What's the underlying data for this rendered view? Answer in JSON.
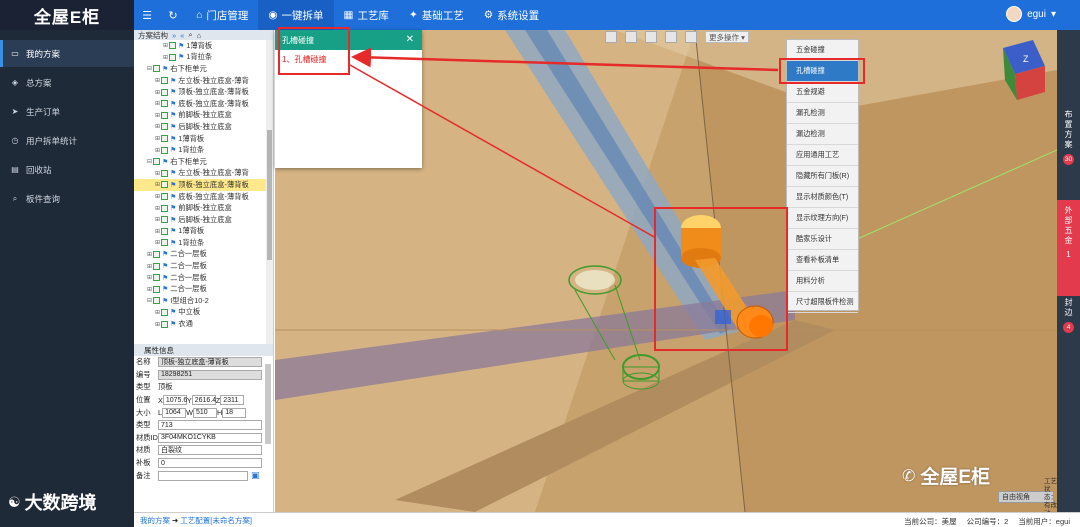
{
  "app": {
    "logo": "全屋E柜"
  },
  "menu": [
    {
      "label": "门店管理",
      "icon": "⌂"
    },
    {
      "label": "一键拆单",
      "icon": "◉"
    },
    {
      "label": "工艺库",
      "icon": "▦"
    },
    {
      "label": "基础工艺",
      "icon": "✦"
    },
    {
      "label": "系统设置",
      "icon": "⚙"
    }
  ],
  "user": {
    "name": "egui"
  },
  "sidebar": [
    {
      "label": "我的方案",
      "icon": "▭"
    },
    {
      "label": "总方案",
      "icon": "◈"
    },
    {
      "label": "生产订单",
      "icon": "➤"
    },
    {
      "label": "用户拆单统计",
      "icon": "◷"
    },
    {
      "label": "回收站",
      "icon": "▤"
    },
    {
      "label": "板件查询",
      "icon": "⌕"
    }
  ],
  "sidebar_footer": "大数跨境",
  "tree": {
    "header": "方案结构",
    "rows": [
      {
        "label": "1薄背板",
        "indent": 3,
        "type": "leaf"
      },
      {
        "label": "1背拉条",
        "indent": 3,
        "type": "leaf"
      },
      {
        "label": "右下柜单元",
        "indent": 1,
        "type": "node"
      },
      {
        "label": "左立板-独立底盒-薄背",
        "indent": 2,
        "type": "leaf"
      },
      {
        "label": "顶板-独立底盒-薄背板",
        "indent": 2,
        "type": "leaf"
      },
      {
        "label": "底板-独立底盒-薄背板",
        "indent": 2,
        "type": "leaf"
      },
      {
        "label": "前脚板-独立底盒",
        "indent": 2,
        "type": "leaf"
      },
      {
        "label": "后脚板-独立底盒",
        "indent": 2,
        "type": "leaf"
      },
      {
        "label": "1薄背板",
        "indent": 2,
        "type": "leaf"
      },
      {
        "label": "1背拉条",
        "indent": 2,
        "type": "leaf"
      },
      {
        "label": "右下柜单元",
        "indent": 1,
        "type": "node"
      },
      {
        "label": "左立板-独立底盒-薄背",
        "indent": 2,
        "type": "leaf"
      },
      {
        "label": "顶板-独立底盒-薄背板",
        "indent": 2,
        "type": "leaf",
        "highlight": true
      },
      {
        "label": "底板-独立底盒-薄背板",
        "indent": 2,
        "type": "leaf"
      },
      {
        "label": "前脚板-独立底盒",
        "indent": 2,
        "type": "leaf"
      },
      {
        "label": "后脚板-独立底盒",
        "indent": 2,
        "type": "leaf"
      },
      {
        "label": "1薄背板",
        "indent": 2,
        "type": "leaf"
      },
      {
        "label": "1背拉条",
        "indent": 2,
        "type": "leaf"
      },
      {
        "label": "二合一层板",
        "indent": 1,
        "type": "leaf"
      },
      {
        "label": "二合一层板",
        "indent": 1,
        "type": "leaf"
      },
      {
        "label": "二合一层板",
        "indent": 1,
        "type": "leaf"
      },
      {
        "label": "二合一层板",
        "indent": 1,
        "type": "leaf"
      },
      {
        "label": "I型组合10-2",
        "indent": 1,
        "type": "node"
      },
      {
        "label": "中立板",
        "indent": 2,
        "type": "leaf"
      },
      {
        "label": "衣通",
        "indent": 2,
        "type": "leaf"
      }
    ]
  },
  "props": {
    "header": "属性信息",
    "name_label": "名称",
    "name_value": "顶板-独立底盒-薄背板",
    "id_label": "编号",
    "id_value": "18298251",
    "type_label": "类型",
    "type_value": "顶板",
    "pos_label": "位置",
    "pos_x": "1075.6",
    "pos_y": "2616.4",
    "pos_z": "2311",
    "size_label": "大小",
    "size_l": "1064",
    "size_w": "510",
    "size_h": "18",
    "kind_label": "类型",
    "kind_value": "713",
    "mat_id_label": "材质ID",
    "mat_id_value": "3F04MKO1CYKB",
    "mat_label": "材质",
    "mat_value": "白裂纹",
    "patch_label": "补板",
    "patch_value": "0",
    "note_label": "备注",
    "note_value": ""
  },
  "breadcrumb": {
    "root": "我的方案",
    "arrow": "➜",
    "current": "工艺配置[未命名方案]"
  },
  "status": {
    "company": "当前公司：美屋",
    "company_no": "公司编号：2",
    "user": "当前用户：egui"
  },
  "dialog": {
    "title": "孔槽碰撞",
    "item": "1、孔槽碰撞"
  },
  "more_ops": "更多操作 ▾",
  "dropdown": [
    {
      "label": "五金碰撞"
    },
    {
      "label": "孔槽碰撞",
      "active": true
    },
    {
      "label": "五金规避"
    },
    {
      "label": "漏孔检测"
    },
    {
      "label": "漏边检测"
    },
    {
      "label": "应用通用工艺"
    },
    {
      "label": "隐藏所有门板(R)"
    },
    {
      "label": "显示材质颜色(T)"
    },
    {
      "label": "显示纹理方向(F)"
    },
    {
      "label": "酷家乐设计"
    },
    {
      "label": "查看补板清单"
    },
    {
      "label": "用料分析"
    },
    {
      "label": "尺寸超限板件检测"
    }
  ],
  "right_strip": [
    {
      "label": "布置方案",
      "badge": "30"
    },
    {
      "label": "外部五金",
      "badge": "1"
    },
    {
      "label": "封边",
      "badge": "4"
    }
  ],
  "watermark": "全屋E柜",
  "view_select": "自由视角",
  "side_note": "工艺状态：有改动",
  "colors": {
    "topbar": "#1e6fd9",
    "sidebar": "#1f2a38",
    "dialog_header": "#17a085",
    "annotation": "#e62a2a"
  }
}
